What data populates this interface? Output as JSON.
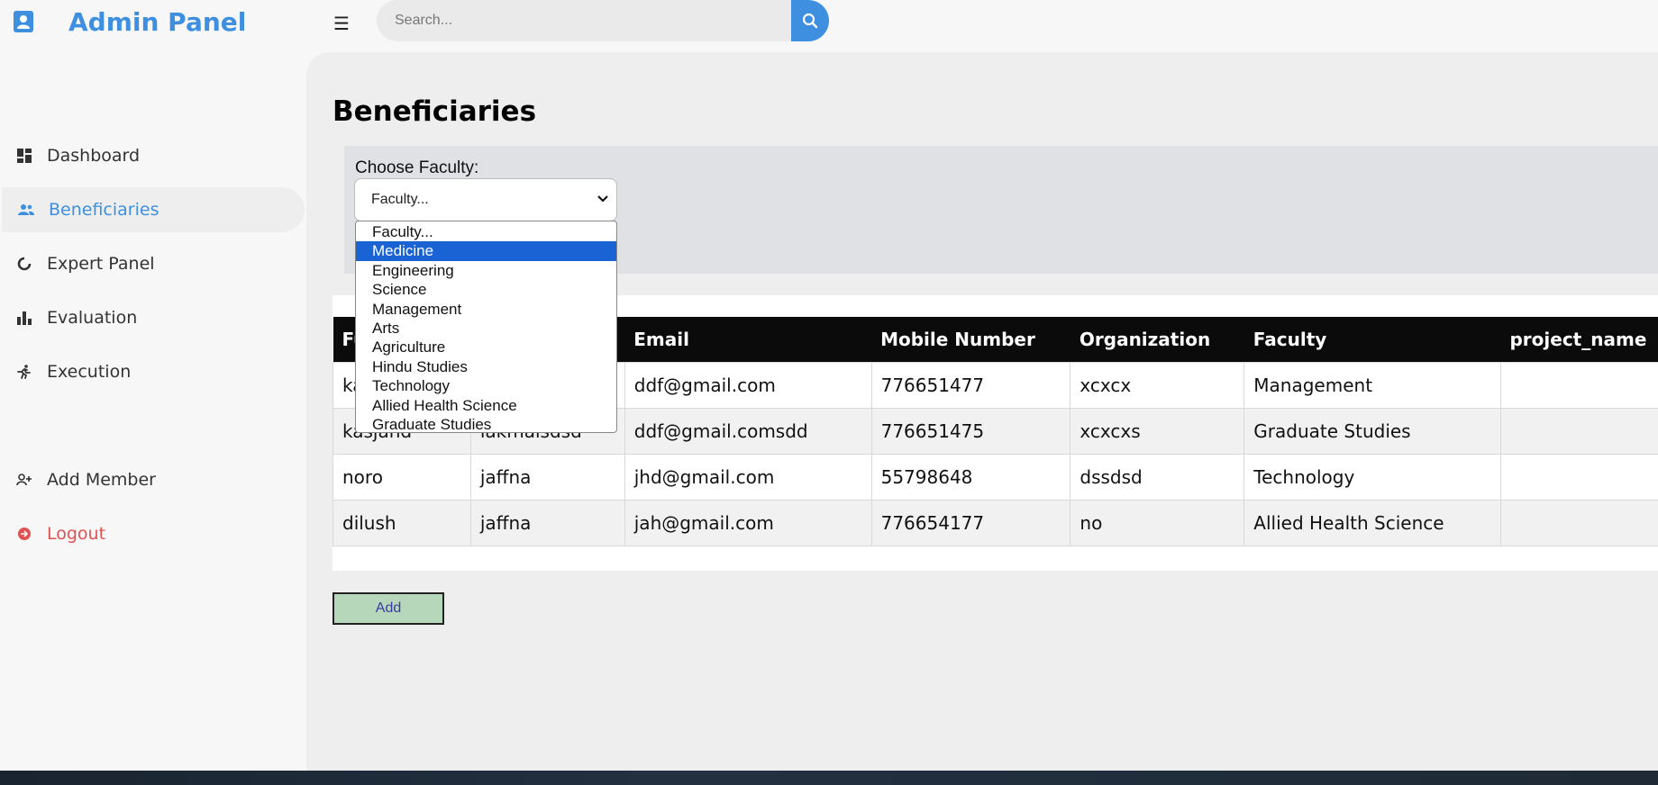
{
  "header": {
    "title": "Admin Panel",
    "search_placeholder": "Search..."
  },
  "sidebar": {
    "items": [
      {
        "label": "Dashboard",
        "icon": "dashboard-icon"
      },
      {
        "label": "Beneficiaries",
        "icon": "users-icon",
        "active": true
      },
      {
        "label": "Expert Panel",
        "icon": "circle-arrow-icon"
      },
      {
        "label": "Evaluation",
        "icon": "bar-chart-icon"
      },
      {
        "label": "Execution",
        "icon": "running-icon"
      },
      {
        "label": "Add Member",
        "icon": "user-plus-icon"
      },
      {
        "label": "Logout",
        "icon": "logout-icon"
      }
    ]
  },
  "main": {
    "title": "Beneficiaries",
    "filter": {
      "label": "Choose Faculty:",
      "selected": "Faculty...",
      "options": [
        "Faculty...",
        "Medicine",
        "Engineering",
        "Science",
        "Management",
        "Arts",
        "Agriculture",
        "Hindu Studies",
        "Technology",
        "Allied Health Science",
        "Graduate Studies"
      ],
      "highlighted": "Medicine"
    },
    "table": {
      "columns": [
        "Fu",
        "",
        "Email",
        "Mobile Number",
        "Organization",
        "Faculty",
        "project_name"
      ],
      "rows": [
        [
          "ka",
          "",
          "ddf@gmail.com",
          "776651477",
          "xcxcx",
          "Management",
          ""
        ],
        [
          "kasjand",
          "lakmalsdsd",
          "ddf@gmail.comsdd",
          "776651475",
          "xcxcxs",
          "Graduate Studies",
          ""
        ],
        [
          "noro",
          "jaffna",
          "jhd@gmail.com",
          "55798648",
          "dssdsd",
          "Technology",
          ""
        ],
        [
          "dilush",
          "jaffna",
          "jah@gmail.com",
          "776654177",
          "no",
          "Allied Health Science",
          ""
        ]
      ]
    },
    "add_label": "Add"
  },
  "colors": {
    "accent": "#3f8fe0",
    "logout": "#e05252",
    "table_header": "#0b0b0b",
    "add_button": "#b6d7b9",
    "dropdown_highlight": "#1a63d4"
  }
}
